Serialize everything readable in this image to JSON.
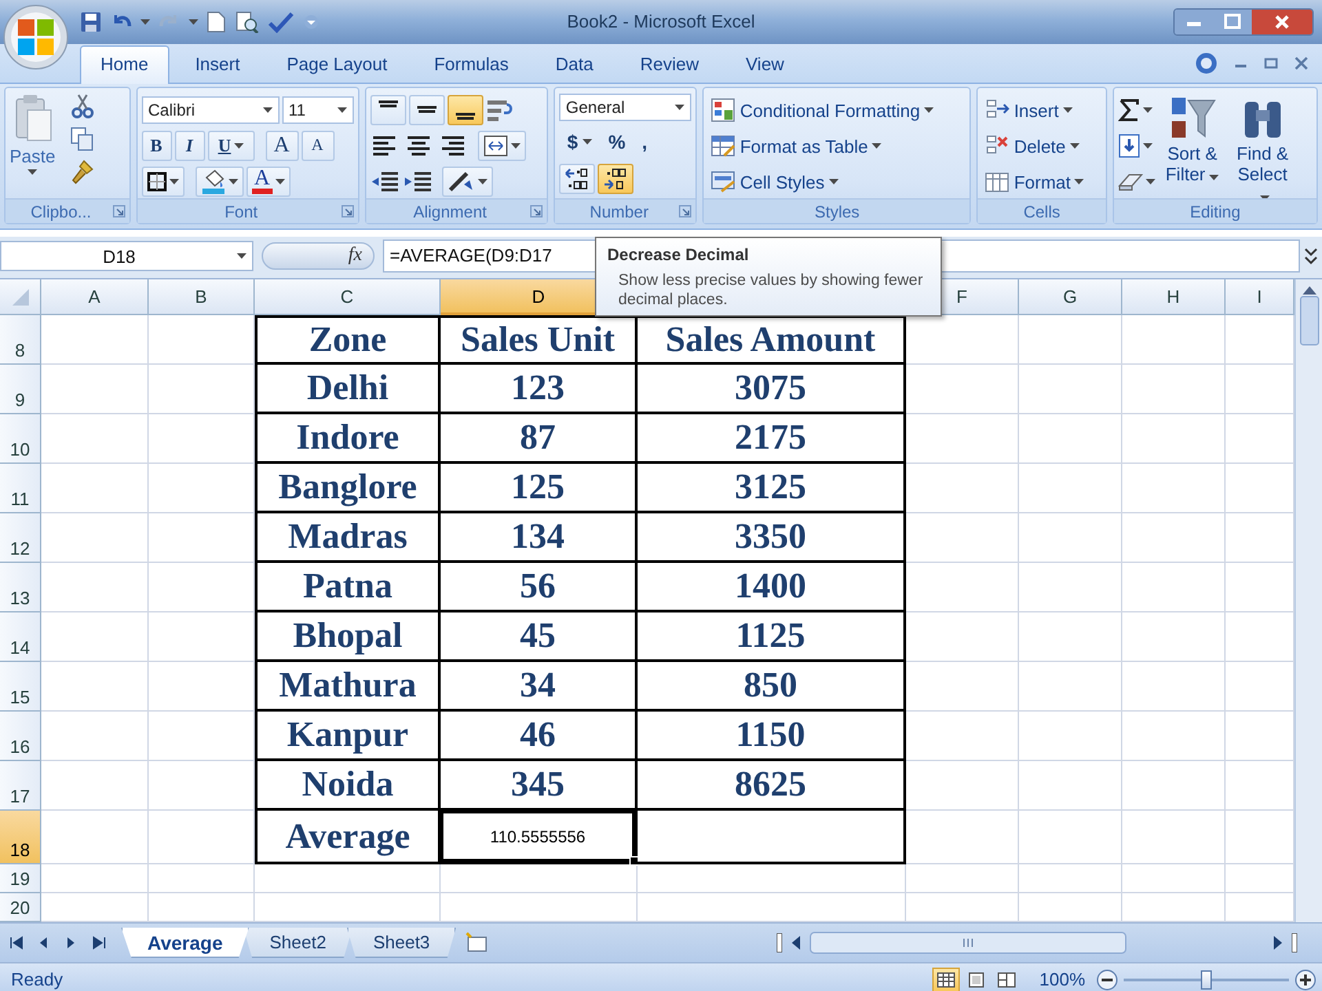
{
  "window": {
    "title": "Book2 - Microsoft Excel"
  },
  "ribbon_tabs": [
    {
      "label": "Home",
      "selected": true
    },
    {
      "label": "Insert",
      "selected": false
    },
    {
      "label": "Page Layout",
      "selected": false
    },
    {
      "label": "Formulas",
      "selected": false
    },
    {
      "label": "Data",
      "selected": false
    },
    {
      "label": "Review",
      "selected": false
    },
    {
      "label": "View",
      "selected": false
    }
  ],
  "clipboard": {
    "paste_label": "Paste",
    "group_label": "Clipbo..."
  },
  "font": {
    "name": "Calibri",
    "size": "11",
    "style_buttons": [
      "B",
      "I",
      "U"
    ],
    "size_buttons": [
      "A",
      "A"
    ],
    "color_button": "A",
    "group_label": "Font"
  },
  "alignment": {
    "vertical_buttons": [
      {
        "selected": false
      },
      {
        "selected": false
      },
      {
        "selected": true
      }
    ],
    "group_label": "Alignment"
  },
  "number": {
    "format": "General",
    "symbol_buttons": [
      "$",
      "%",
      ","
    ],
    "decrease_decimal_hovered": true,
    "group_label": "Number"
  },
  "styles": {
    "commands": [
      "Conditional Formatting",
      "Format as Table",
      "Cell Styles"
    ],
    "group_label": "Styles"
  },
  "cells": {
    "commands": [
      "Insert",
      "Delete",
      "Format"
    ],
    "group_label": "Cells"
  },
  "editing": {
    "commands": [
      "Sort & Filter",
      "Find & Select"
    ],
    "group_label": "Editing"
  },
  "formula_bar": {
    "name_box": "D18",
    "function_label": "fx",
    "formula": "=AVERAGE(D9:D17"
  },
  "tooltip": {
    "title": "Decrease Decimal",
    "text": "Show less precise values by showing fewer decimal places."
  },
  "columns": [
    {
      "kind": "labeled",
      "label": "A",
      "selected": false
    },
    {
      "kind": "labeled",
      "label": "B",
      "selected": false
    },
    {
      "kind": "labeled",
      "label": "C",
      "selected": false
    },
    {
      "kind": "labeled",
      "label": "D",
      "selected": true
    },
    {
      "kind": "covered"
    },
    {
      "kind": "labeled",
      "label": "F",
      "selected": false
    },
    {
      "kind": "labeled",
      "label": "G",
      "selected": false
    },
    {
      "kind": "labeled",
      "label": "H",
      "selected": false
    },
    {
      "kind": "labeled",
      "label": "I",
      "selected": false
    }
  ],
  "rows": [
    {
      "header": "8",
      "selected": false,
      "kind": "header",
      "cells": [
        "Zone",
        "Sales Unit",
        "Sales Amount"
      ]
    },
    {
      "header": "9",
      "selected": false,
      "kind": "data",
      "cells": [
        "Delhi",
        "123",
        "3075"
      ]
    },
    {
      "header": "10",
      "selected": false,
      "kind": "data",
      "cells": [
        "Indore",
        "87",
        "2175"
      ]
    },
    {
      "header": "11",
      "selected": false,
      "kind": "data",
      "cells": [
        "Banglore",
        "125",
        "3125"
      ]
    },
    {
      "header": "12",
      "selected": false,
      "kind": "data",
      "cells": [
        "Madras",
        "134",
        "3350"
      ]
    },
    {
      "header": "13",
      "selected": false,
      "kind": "data",
      "cells": [
        "Patna",
        "56",
        "1400"
      ]
    },
    {
      "header": "14",
      "selected": false,
      "kind": "data",
      "cells": [
        "Bhopal",
        "45",
        "1125"
      ]
    },
    {
      "header": "15",
      "selected": false,
      "kind": "data",
      "cells": [
        "Mathura",
        "34",
        "850"
      ]
    },
    {
      "header": "16",
      "selected": false,
      "kind": "data",
      "cells": [
        "Kanpur",
        "46",
        "1150"
      ]
    },
    {
      "header": "17",
      "selected": false,
      "kind": "data",
      "cells": [
        "Noida",
        "345",
        "8625"
      ]
    },
    {
      "header": "18",
      "selected": true,
      "kind": "total",
      "cells": [
        "Average",
        "110.5555556"
      ]
    },
    {
      "header": "19",
      "selected": false,
      "kind": "empty"
    },
    {
      "header": "20",
      "selected": false,
      "kind": "empty"
    }
  ],
  "sheet_tabs": [
    {
      "label": "Average",
      "selected": true
    },
    {
      "label": "Sheet2",
      "selected": false
    },
    {
      "label": "Sheet3",
      "selected": false
    }
  ],
  "status_bar": {
    "status": "Ready",
    "views": [
      {
        "selected": true
      },
      {
        "selected": false
      },
      {
        "selected": false
      }
    ],
    "zoom": "100%",
    "zoom_slider": {
      "level": 0.5
    }
  }
}
